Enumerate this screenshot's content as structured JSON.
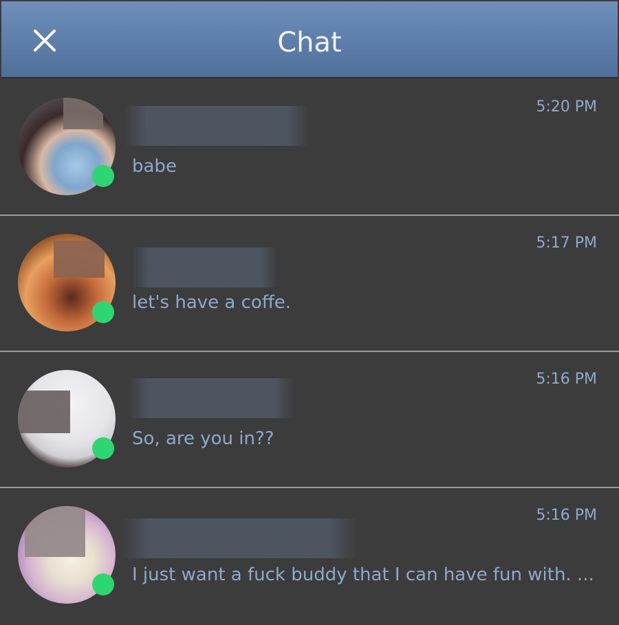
{
  "header": {
    "title": "Chat",
    "close_icon": "close-icon"
  },
  "chats": [
    {
      "time": "5:20 PM",
      "message": "babe",
      "online": true
    },
    {
      "time": "5:17 PM",
      "message": "let's have a coffe.",
      "online": true
    },
    {
      "time": "5:16 PM",
      "message": "So, are you in??",
      "online": true
    },
    {
      "time": "5:16 PM",
      "message": "I just want a fuck buddy that I can have fun with. ...",
      "online": true
    }
  ],
  "colors": {
    "header_top": "#6f8fbb",
    "header_bottom": "#4f6f98",
    "background": "#3c3c3c",
    "text_accent": "#8ea9cf",
    "online": "#2ed573",
    "divider": "#9a9a9a"
  }
}
